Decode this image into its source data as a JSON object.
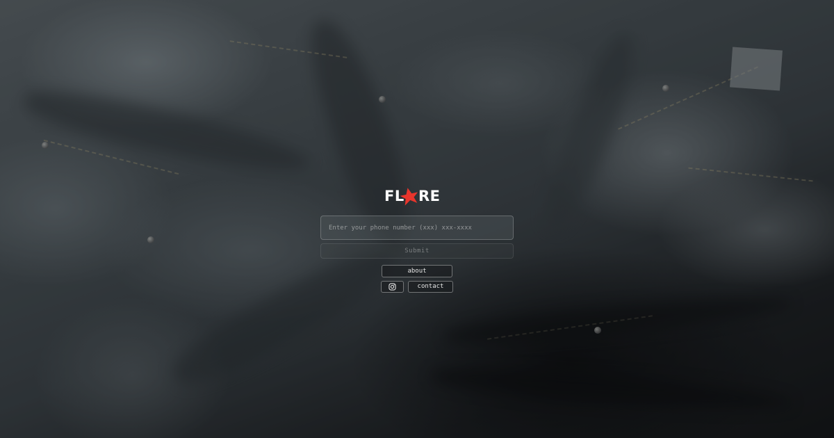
{
  "brand": {
    "logo_text_left": "FL",
    "logo_text_right": "RE",
    "accent_color": "#e8352c"
  },
  "signup": {
    "phone_placeholder": "Enter your phone number (xxx) xxx-xxxx",
    "submit_label": "Submit"
  },
  "nav": {
    "about_label": "about",
    "contact_label": "contact",
    "social_icon": "instagram-icon"
  }
}
